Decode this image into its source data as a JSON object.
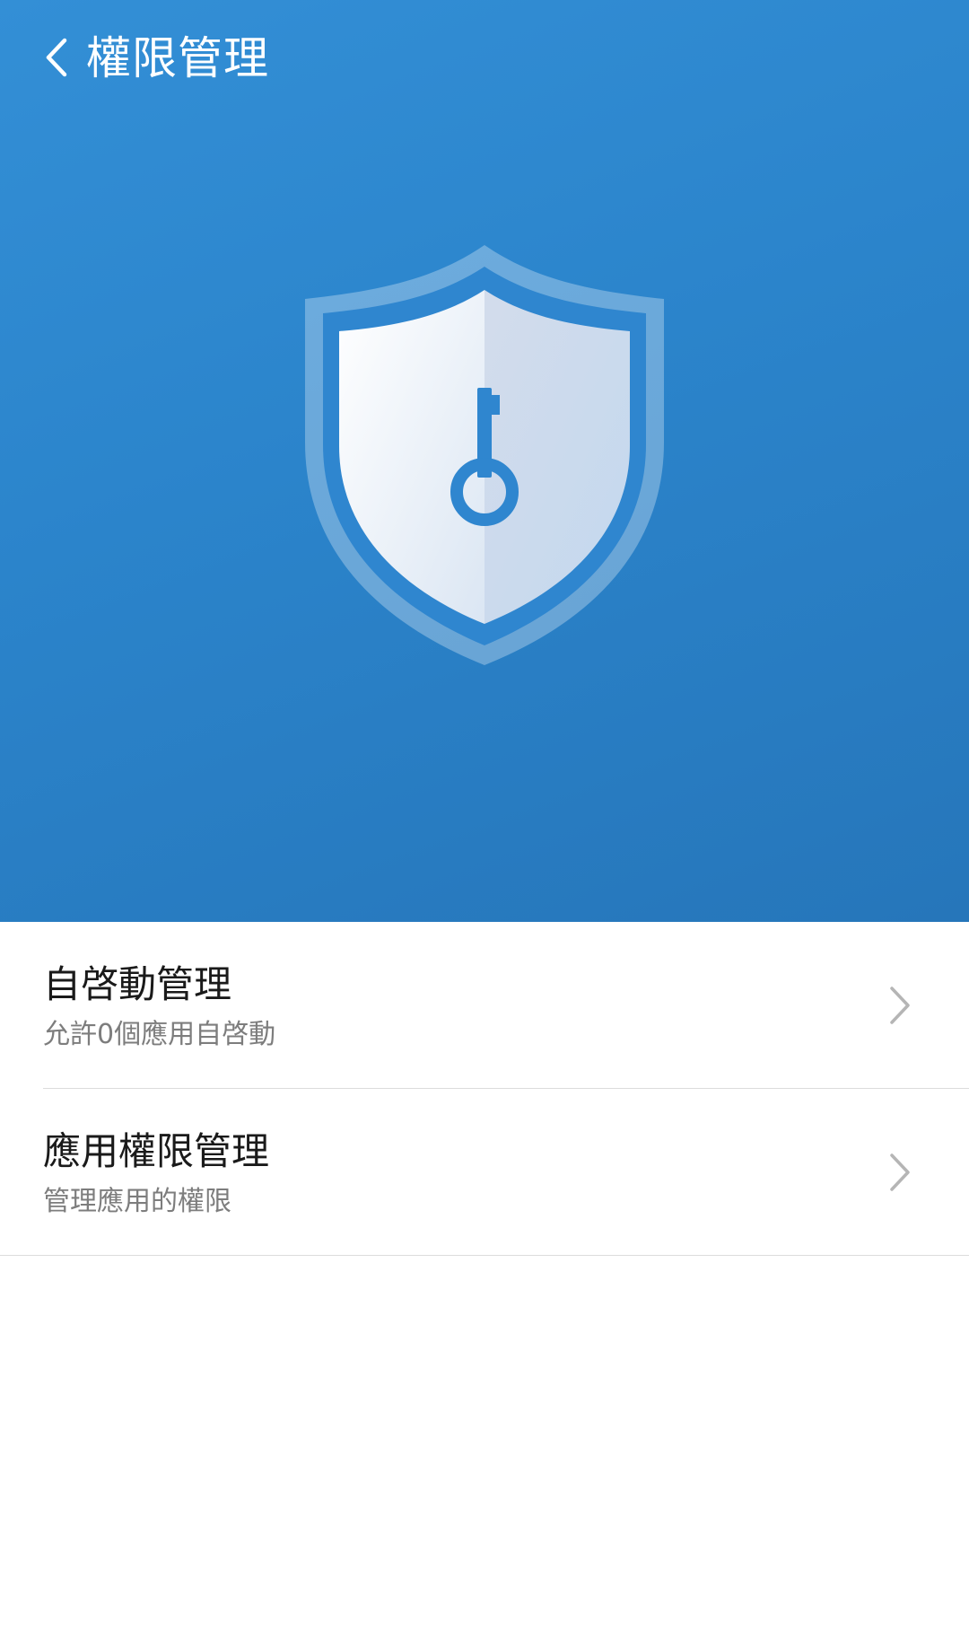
{
  "header": {
    "title": "權限管理",
    "back_icon": "chevron-left-icon",
    "hero_icon": "shield-key-icon"
  },
  "colors": {
    "hero_top": "#338fd6",
    "hero_bottom": "#2676ba",
    "accent": "#2b84cb"
  },
  "menu": {
    "items": [
      {
        "title": "自啓動管理",
        "subtitle": "允許0個應用自啓動",
        "icon": "chevron-right-icon"
      },
      {
        "title": "應用權限管理",
        "subtitle": "管理應用的權限",
        "icon": "chevron-right-icon"
      }
    ]
  }
}
